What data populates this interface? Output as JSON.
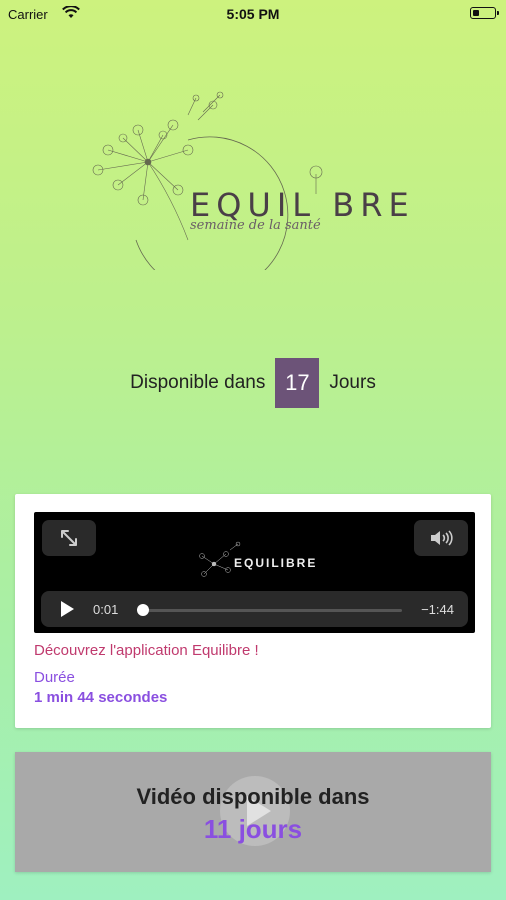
{
  "status": {
    "carrier": "Carrier",
    "time": "5:05 PM",
    "battery_level": 0.35
  },
  "brand": {
    "name": "EQUIL BRE",
    "tagline": "semaine de la santé"
  },
  "countdown": {
    "prefix": "Disponible dans",
    "days": "17",
    "suffix": "Jours"
  },
  "video": {
    "current_time": "0:01",
    "remaining_time": "−1:44",
    "progress": 0.01,
    "mini_brand": "EQUILIBRE",
    "title": "Découvrez l'application Equilibre !",
    "duration_label": "Durée",
    "duration_value": "1 min 44 secondes",
    "icons": [
      "expand-icon",
      "volume-icon",
      "play-icon"
    ]
  },
  "locked_video": {
    "line1": "Vidéo disponible dans",
    "days_text": "11  jours"
  },
  "colors": {
    "accent_purple": "#6c5378",
    "title_pink": "#c03a6e",
    "link_purple": "#8a4fe0"
  }
}
